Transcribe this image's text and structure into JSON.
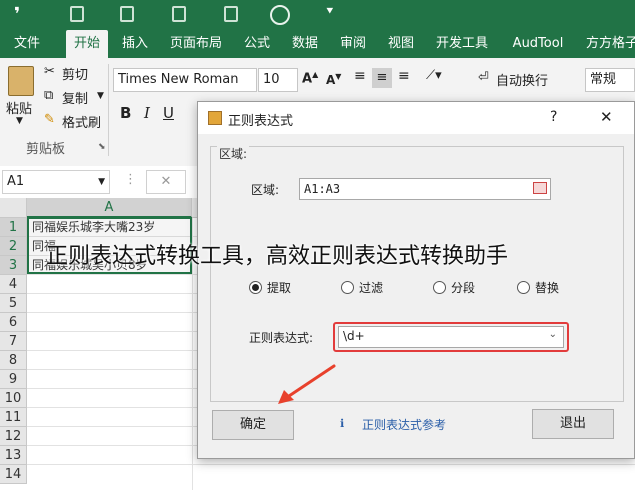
{
  "quick_access": {
    "icons": [
      "save-icon",
      "undo-icon",
      "redo-icon",
      "open-icon",
      "circle-icon",
      "customize-icon"
    ]
  },
  "tabs": [
    {
      "label": "文件"
    },
    {
      "label": "开始"
    },
    {
      "label": "插入"
    },
    {
      "label": "页面布局"
    },
    {
      "label": "公式"
    },
    {
      "label": "数据"
    },
    {
      "label": "审阅"
    },
    {
      "label": "视图"
    },
    {
      "label": "开发工具"
    },
    {
      "label": "AudTool"
    },
    {
      "label": "方方格子"
    }
  ],
  "ribbon": {
    "paste_label": "粘贴",
    "cut_label": "剪切",
    "copy_label": "复制",
    "format_painter_label": "格式刷",
    "clipboard_group": "剪贴板",
    "font_name": "Times New Roman",
    "font_size": "10",
    "bold": "B",
    "italic": "I",
    "underline": "U",
    "wrap_text_label": "自动换行",
    "number_format": "常规"
  },
  "formula_bar": {
    "name_box": "A1",
    "cancel_symbol": "✕"
  },
  "sheet": {
    "column_header": "A",
    "rows": [
      "1",
      "2",
      "3",
      "4",
      "5",
      "6",
      "7",
      "8",
      "9",
      "10",
      "11",
      "12",
      "13",
      "14"
    ],
    "cells": [
      {
        "text": "同福娱乐城李大嘴23岁"
      },
      {
        "text": "同福"
      },
      {
        "text": "同福娱乐城吴小贝8岁"
      }
    ]
  },
  "dialog": {
    "title": "正则表达式",
    "help": "?",
    "close": "✕",
    "group_label": "区域:",
    "range_label": "区域:",
    "range_value": "A1:A3",
    "options": [
      {
        "label": "提取",
        "selected": true
      },
      {
        "label": "过滤",
        "selected": false
      },
      {
        "label": "分段",
        "selected": false
      },
      {
        "label": "替换",
        "selected": false
      }
    ],
    "regex_label": "正则表达式:",
    "regex_value": "\\d+",
    "ok_label": "确定",
    "reference_link": "正则表达式参考",
    "exit_label": "退出"
  },
  "overlay_caption": "正则表达式转换工具，高效正则表达式转换助手",
  "colors": {
    "excel_green": "#217346",
    "arrow_red": "#e8412c",
    "regex_box_border": "#e23c3c"
  }
}
